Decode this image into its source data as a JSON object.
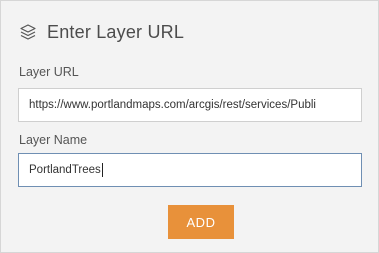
{
  "dialog": {
    "title": "Enter Layer URL",
    "header_icon": "layers-icon"
  },
  "form": {
    "layer_url_label": "Layer URL",
    "layer_url_value": "https://www.portlandmaps.com/arcgis/rest/services/Publi",
    "layer_name_label": "Layer Name",
    "layer_name_value": "PortlandTrees"
  },
  "actions": {
    "add_label": "ADD"
  },
  "colors": {
    "accent": "#e8913a",
    "background": "#f3f3f3",
    "active_border": "#6f8fb3"
  }
}
